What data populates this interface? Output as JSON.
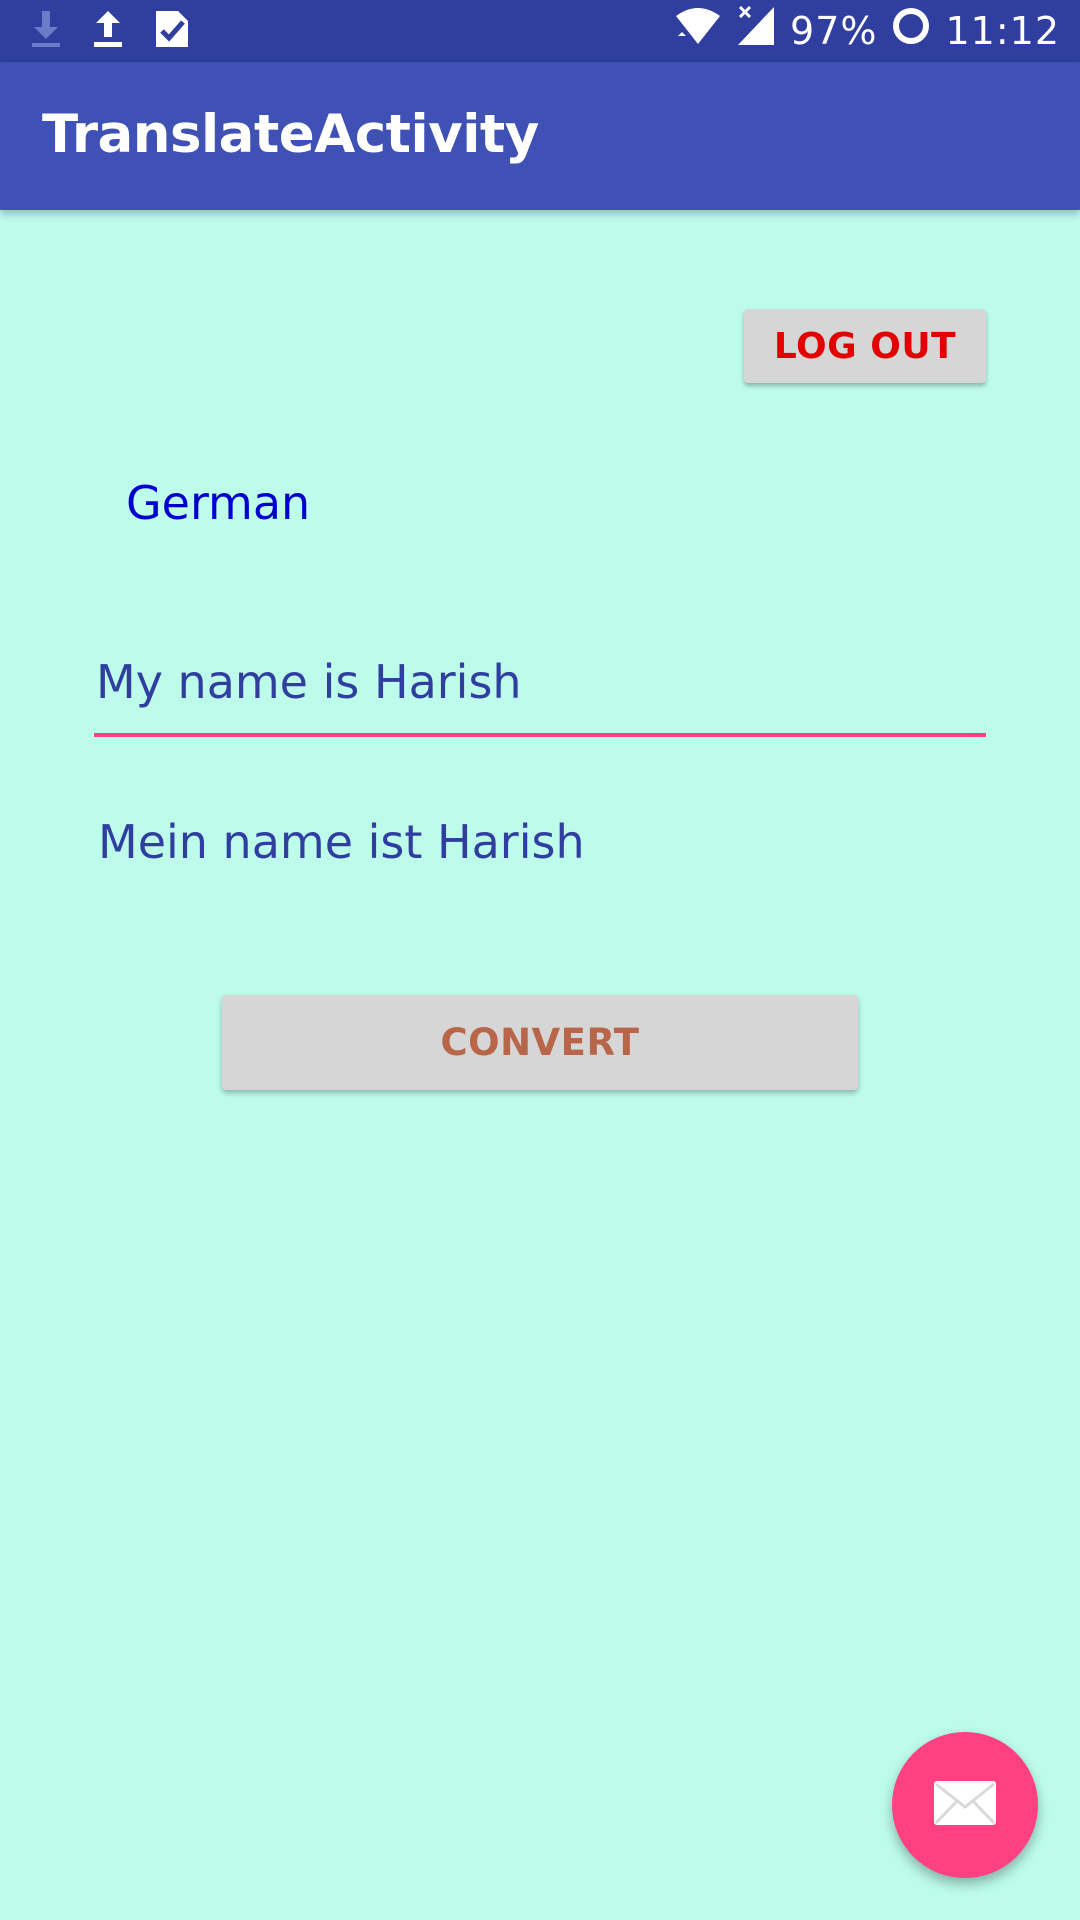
{
  "status_bar": {
    "battery": "97%",
    "time": "11:12",
    "icons": [
      "download-icon",
      "upload-icon",
      "task-done-icon",
      "wifi-icon",
      "cellular-no-signal-icon",
      "battery-icon"
    ]
  },
  "app_bar": {
    "title": "TranslateActivity"
  },
  "logout_button": {
    "label": "LOG OUT"
  },
  "language": {
    "label": "German"
  },
  "input": {
    "value": "My name is Harish"
  },
  "output": {
    "text": "Mein name ist Harish"
  },
  "convert_button": {
    "label": "CONVERT"
  },
  "fab": {
    "icon": "mail-icon"
  },
  "colors": {
    "background": "#BDFCEB",
    "status_bar": "#303F9F",
    "app_bar": "#3F51B5",
    "accent": "#FF4081",
    "logout_text": "#E30000",
    "convert_text": "#B8664A",
    "language_text": "#0000CC",
    "body_text": "#303F9F"
  }
}
